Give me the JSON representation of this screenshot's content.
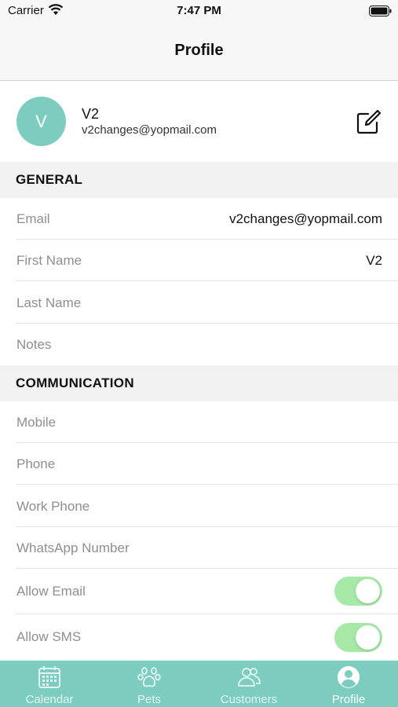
{
  "status_bar": {
    "carrier": "Carrier",
    "time": "7:47 PM"
  },
  "nav": {
    "title": "Profile"
  },
  "profile": {
    "initial": "V",
    "name": "V2",
    "email": "v2changes@yopmail.com"
  },
  "general": {
    "header": "GENERAL",
    "rows": [
      {
        "label": "Email",
        "value": "v2changes@yopmail.com"
      },
      {
        "label": "First Name",
        "value": "V2"
      },
      {
        "label": "Last Name",
        "value": ""
      },
      {
        "label": "Notes",
        "value": ""
      }
    ]
  },
  "communication": {
    "header": "COMMUNICATION",
    "rows": [
      {
        "label": "Mobile"
      },
      {
        "label": "Phone"
      },
      {
        "label": "Work Phone"
      },
      {
        "label": "WhatsApp Number"
      }
    ],
    "toggles": [
      {
        "label": "Allow Email",
        "on": true
      },
      {
        "label": "Allow SMS",
        "on": true
      }
    ]
  },
  "tabs": [
    {
      "label": "Calendar",
      "icon": "calendar-icon",
      "active": false
    },
    {
      "label": "Pets",
      "icon": "paw-icon",
      "active": false
    },
    {
      "label": "Customers",
      "icon": "customers-icon",
      "active": false
    },
    {
      "label": "Profile",
      "icon": "profile-icon",
      "active": true
    }
  ],
  "colors": {
    "accent": "#7ccdbf",
    "toggle_on": "#a6e9a6",
    "section_bg": "#f2f2f2",
    "label_gray": "#8e8e93"
  }
}
